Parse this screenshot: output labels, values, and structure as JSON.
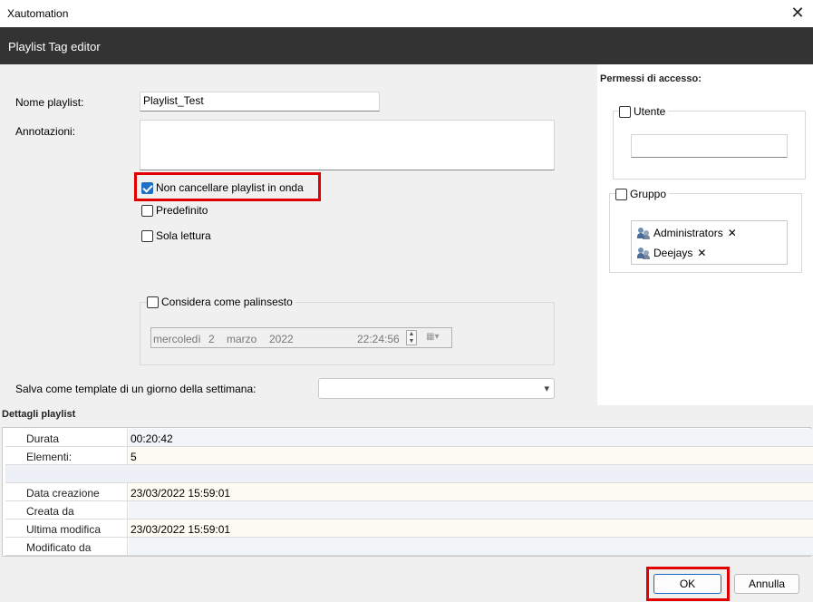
{
  "window": {
    "title": "Xautomation",
    "close_glyph": "✕"
  },
  "header": {
    "title": "Playlist Tag editor"
  },
  "form": {
    "name_label": "Nome playlist:",
    "name_value": "Playlist_Test",
    "notes_label": "Annotazioni:",
    "notes_value": "",
    "chk_no_delete": {
      "label": "Non cancellare playlist in onda",
      "checked": true
    },
    "chk_default": {
      "label": "Predefinito",
      "checked": false
    },
    "chk_readonly": {
      "label": "Sola lettura",
      "checked": false
    },
    "chk_schedule": {
      "label": "Considera come palinsesto",
      "checked": false
    },
    "date": {
      "weekday": "mercoledì",
      "day": "2",
      "month": "marzo",
      "year": "2022",
      "time": "22:24:56"
    },
    "template_label": "Salva come template di un giorno della settimana:",
    "template_value": ""
  },
  "access": {
    "title": "Permessi di accesso:",
    "user": {
      "label": "Utente",
      "checked": false,
      "value": ""
    },
    "group": {
      "label": "Gruppo",
      "checked": false,
      "items": [
        {
          "name": "Administrators"
        },
        {
          "name": "Deejays"
        }
      ]
    },
    "remove_glyph": "✕"
  },
  "details": {
    "title": "Dettagli playlist",
    "rows": [
      {
        "key": "Durata",
        "value": "00:20:42"
      },
      {
        "key": "Elementi:",
        "value": "5"
      },
      {
        "key": "",
        "value": ""
      },
      {
        "key": "Data creazione",
        "value": "23/03/2022 15:59:01"
      },
      {
        "key": "Creata da",
        "value": ""
      },
      {
        "key": "Ultima modifica",
        "value": "23/03/2022 15:59:01"
      },
      {
        "key": "Modificato da",
        "value": ""
      }
    ]
  },
  "buttons": {
    "ok": "OK",
    "cancel": "Annulla"
  },
  "colors": {
    "header_bg": "#333333",
    "highlight": "#e00000",
    "check_blue": "#1f6fc5"
  }
}
